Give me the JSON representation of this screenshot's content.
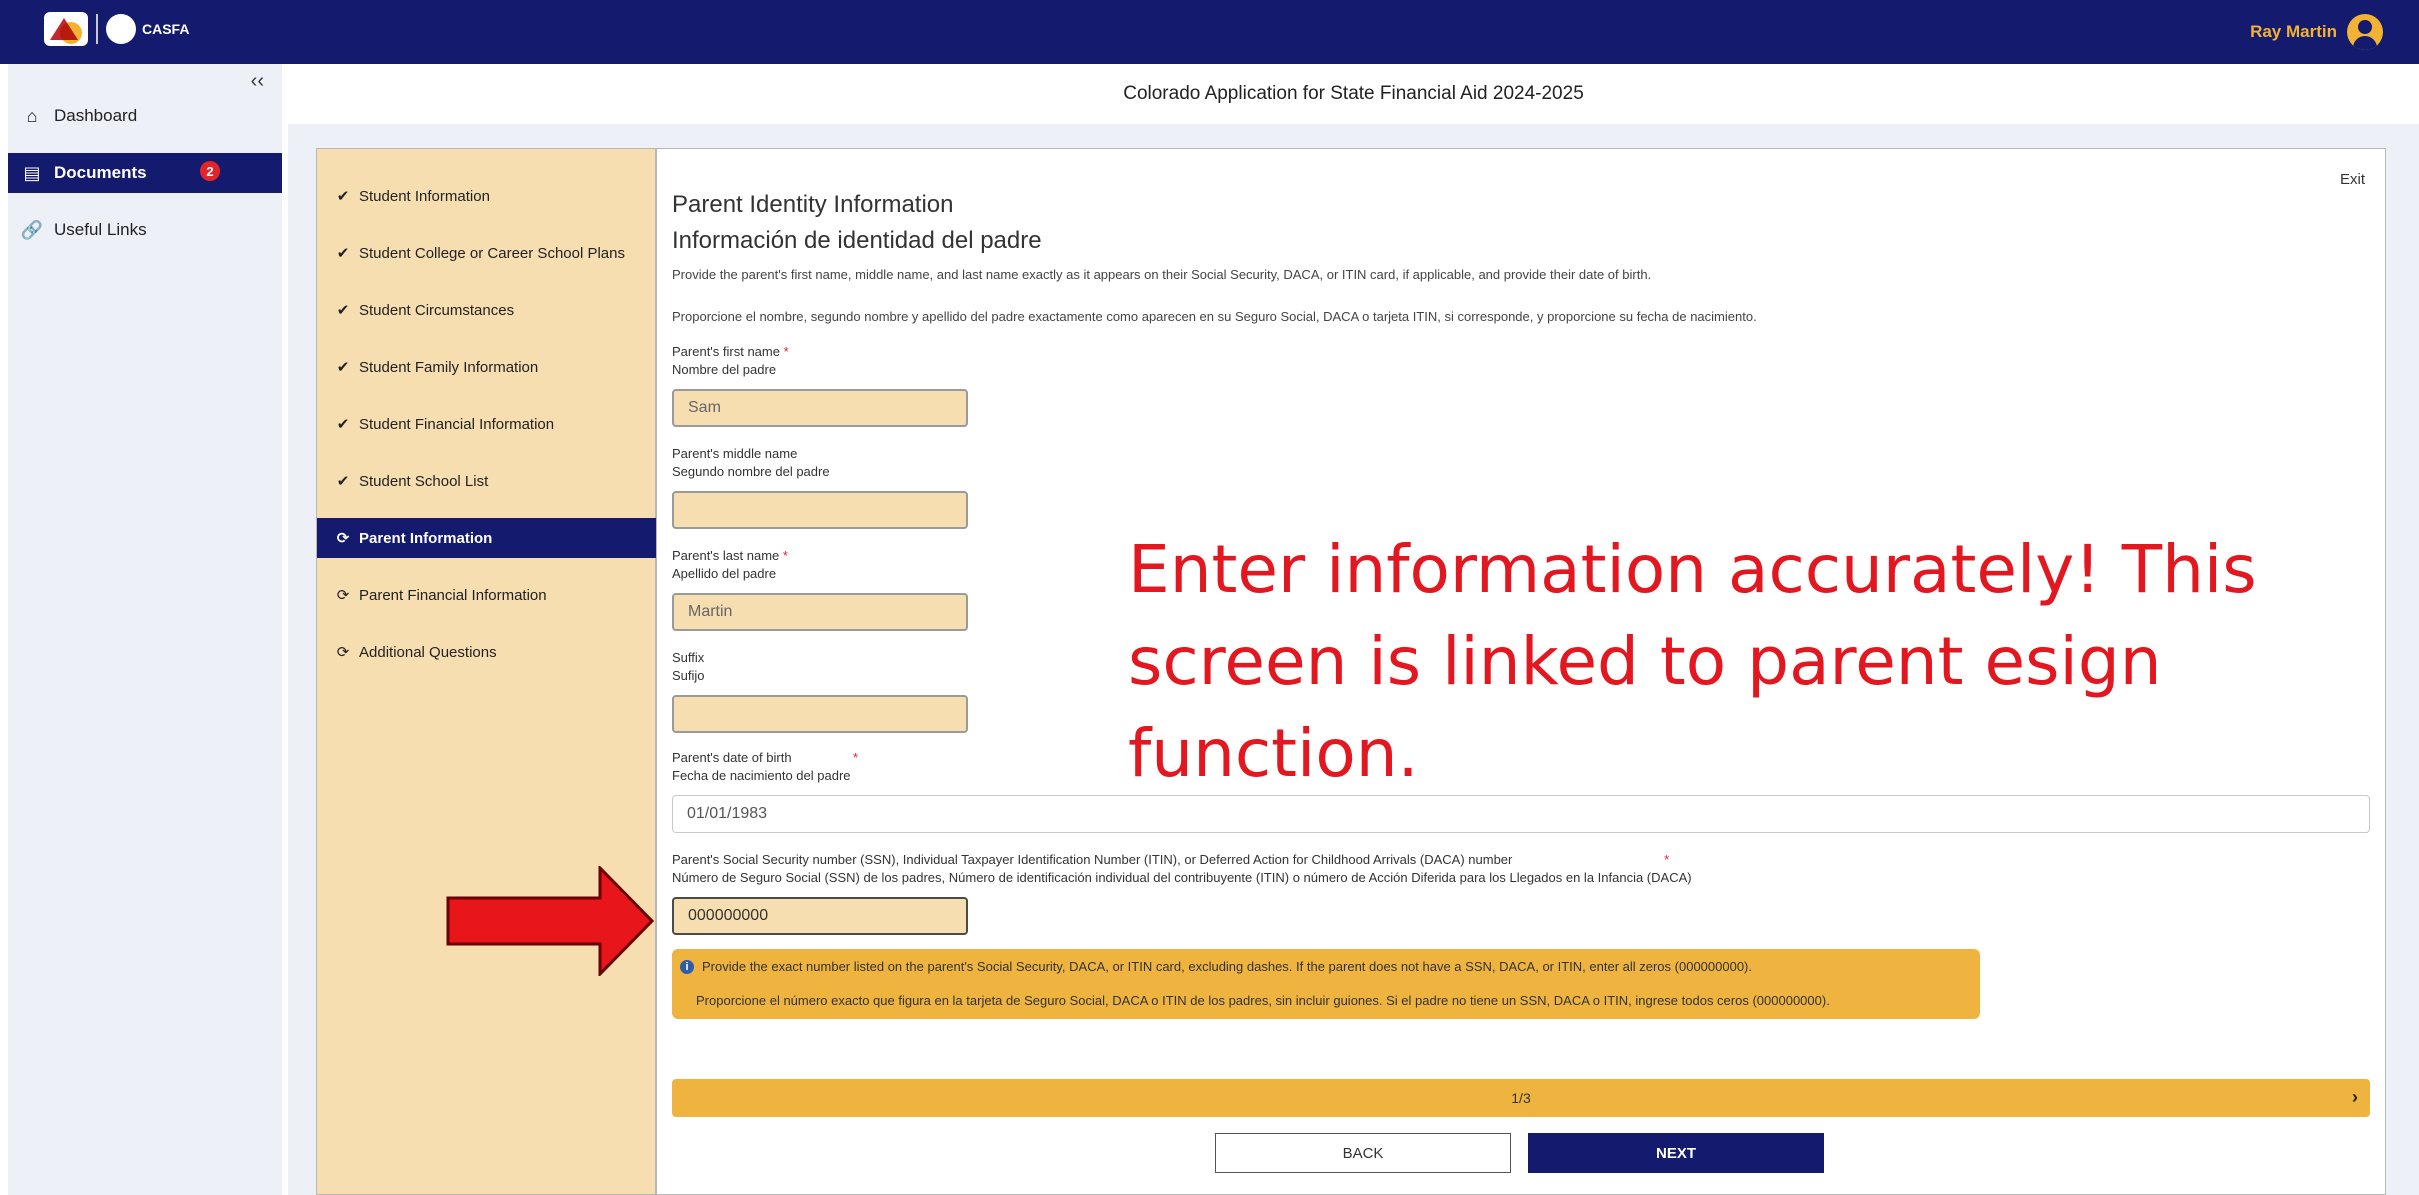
{
  "header": {
    "logo_text": "CASFA",
    "user_name": "Ray Martin",
    "icons": {
      "logo": "colorado-logo-icon",
      "user": "user-circle-icon"
    }
  },
  "sidebar": {
    "collapse_label": "‹‹",
    "items": [
      {
        "label": "Dashboard",
        "icon": "home-icon"
      },
      {
        "label": "Documents",
        "icon": "document-icon",
        "badge": "2"
      },
      {
        "label": "Useful Links",
        "icon": "link-icon"
      }
    ]
  },
  "app_title": "Colorado Application for State Financial Aid 2024-2025",
  "steps": [
    {
      "label": "Student Information",
      "status": "done"
    },
    {
      "label": "Student College or Career School Plans",
      "status": "done"
    },
    {
      "label": "Student Circumstances",
      "status": "done"
    },
    {
      "label": "Student Family Information",
      "status": "done"
    },
    {
      "label": "Student Financial Information",
      "status": "done"
    },
    {
      "label": "Student School List",
      "status": "done"
    },
    {
      "label": "Parent Information",
      "status": "current"
    },
    {
      "label": "Parent Financial Information",
      "status": "pending"
    },
    {
      "label": "Additional Questions",
      "status": "pending"
    }
  ],
  "form": {
    "exit_label": "Exit",
    "title_en": "Parent Identity Information",
    "title_es": "Información de identidad del padre",
    "desc_en": "Provide the parent's first name, middle name, and last name exactly as it appears on their Social Security, DACA, or ITIN card, if applicable, and provide their date of birth.",
    "desc_es": "Proporcione el nombre, segundo nombre y apellido del padre exactamente como aparecen en su Seguro Social, DACA o tarjeta ITIN, si corresponde, y proporcione su fecha de nacimiento.",
    "first_name": {
      "label_en": "Parent's first name",
      "label_es": "Nombre del padre",
      "required": "*",
      "value": "Sam"
    },
    "middle_name": {
      "label_en": "Parent's middle name",
      "label_es": "Segundo nombre del padre",
      "value": ""
    },
    "last_name": {
      "label_en": "Parent's last name",
      "label_es": "Apellido del padre",
      "required": "*",
      "value": "Martin"
    },
    "suffix": {
      "label_en": "Suffix",
      "label_es": "Sufijo",
      "value": ""
    },
    "dob": {
      "label_en": "Parent's date of birth",
      "label_es": "Fecha de nacimiento del padre",
      "required": "*",
      "value": "01/01/1983"
    },
    "ssn": {
      "label_en": "Parent's Social Security number (SSN), Individual Taxpayer Identification Number (ITIN), or Deferred Action for Childhood Arrivals (DACA) number",
      "label_es": "Número de Seguro Social (SSN) de los padres, Número de identificación individual del contribuyente (ITIN) o número de Acción Diferida para los Llegados en la Infancia (DACA)",
      "required": "*",
      "value": "000000000"
    },
    "info_en": "Provide the exact number listed on the parent's Social Security, DACA, or ITIN card, excluding dashes. If the parent does not have a SSN, DACA, or ITIN, enter all zeros (000000000).",
    "info_es": "Proporcione el número exacto que figura en la tarjeta de Seguro Social, DACA o ITIN de los padres, sin incluir guiones. Si el padre no tiene un SSN, DACA o ITIN, ingrese todos ceros (000000000).",
    "progress_label": "1/3",
    "back_label": "BACK",
    "next_label": "NEXT"
  },
  "annotation": {
    "text": "Enter information accurately! This screen is linked to parent esign function.",
    "color": "#e3171f"
  },
  "colors": {
    "navy": "#141a6e",
    "tan": "#f7deb1",
    "gold": "#efb440",
    "red": "#e3252a"
  }
}
